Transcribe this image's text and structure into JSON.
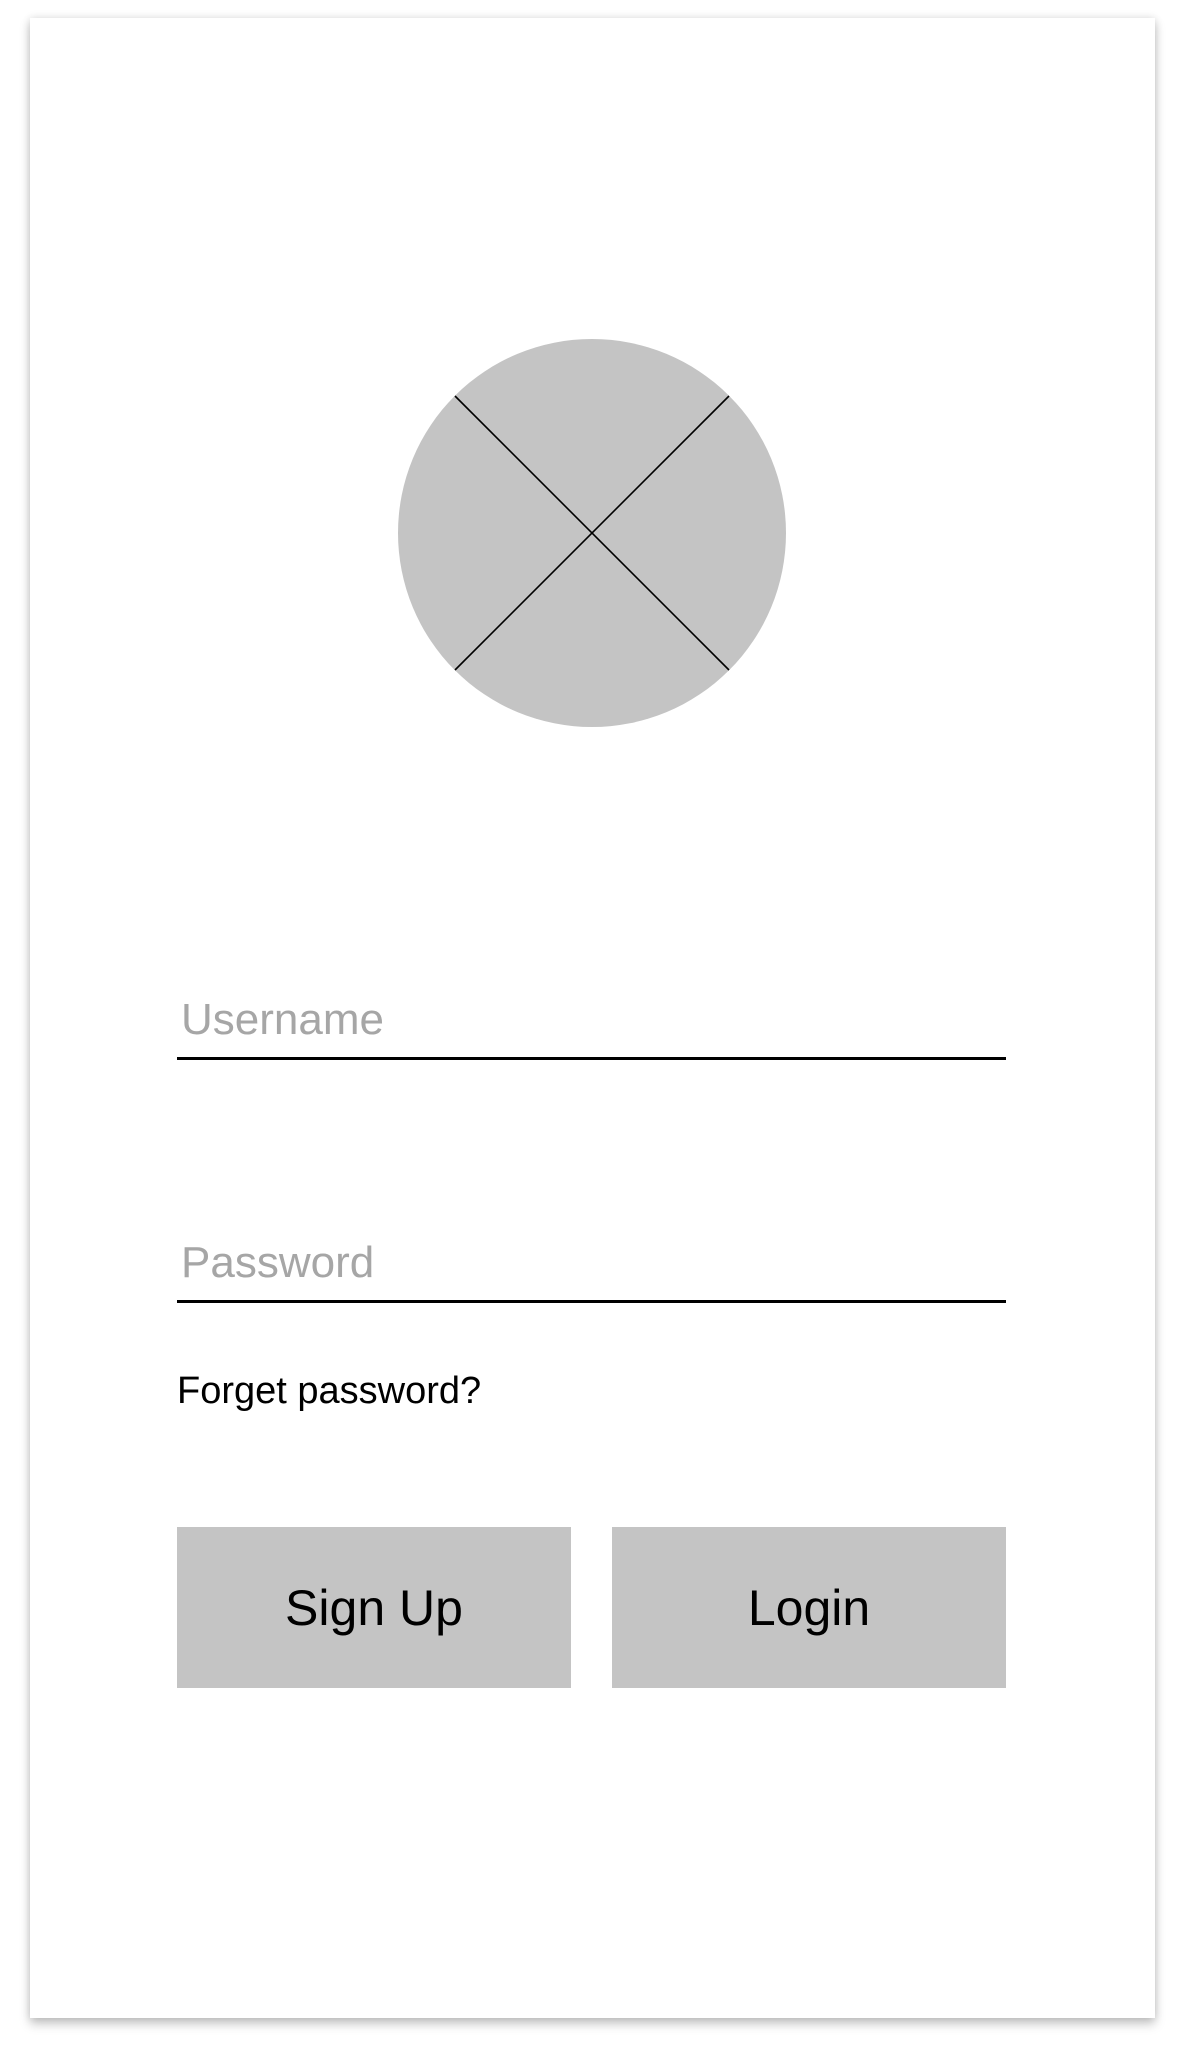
{
  "logo": {
    "icon": "image-placeholder-icon",
    "fill_color": "#c4c4c4",
    "stroke_color": "#000000"
  },
  "form": {
    "username": {
      "placeholder": "Username",
      "value": ""
    },
    "password": {
      "placeholder": "Password",
      "value": ""
    },
    "forgot_label": "Forget password?"
  },
  "actions": {
    "signup_label": "Sign Up",
    "login_label": "Login",
    "button_color": "#c4c4c4"
  }
}
